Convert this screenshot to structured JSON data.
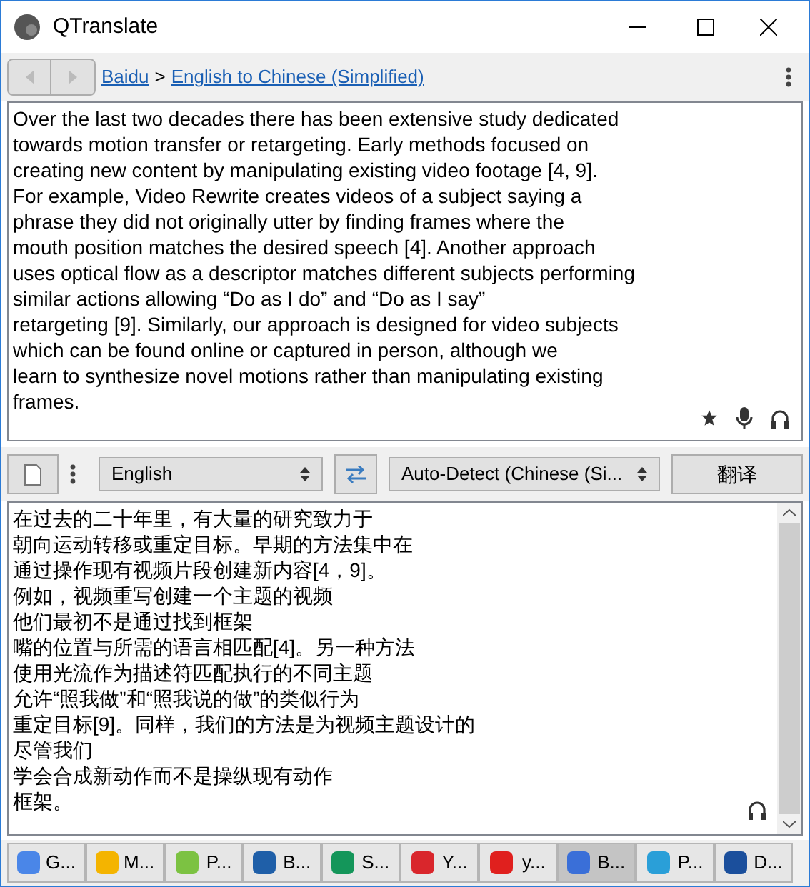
{
  "window": {
    "title": "QTranslate"
  },
  "nav": {
    "service": "Baidu",
    "separator": ">",
    "direction": "English to Chinese (Simplified)"
  },
  "source_text": [
    "Over the last two decades there has been extensive study dedicated",
    "towards motion transfer or retargeting. Early methods focused on",
    "creating new content by manipulating existing video footage [4, 9].",
    "For example, Video Rewrite creates videos of a subject saying a",
    "phrase they did not originally utter by finding frames where the",
    "mouth position matches the desired speech [4]. Another approach",
    "uses optical flow as a descriptor matches different subjects performing",
    "similar actions allowing “Do as I do” and “Do as I say”",
    "retargeting [9]. Similarly, our approach is designed for video subjects",
    "which can be found online or captured in person, although we",
    "learn to synthesize novel motions rather than manipulating existing",
    "frames."
  ],
  "toolbar": {
    "source_language": "English",
    "target_language": "Auto-Detect (Chinese (Si...",
    "translate_button": "翻译"
  },
  "translation_text": [
    "在过去的二十年里，有大量的研究致力于",
    "朝向运动转移或重定目标。早期的方法集中在",
    "通过操作现有视频片段创建新内容[4，9]。",
    "例如，视频重写创建一个主题的视频",
    "他们最初不是通过找到框架",
    "嘴的位置与所需的语言相匹配[4]。另一种方法",
    "使用光流作为描述符匹配执行的不同主题",
    "允许“照我做”和“照我说的做”的类似行为",
    "重定目标[9]。同样，我们的方法是为视频主题设计的",
    "尽管我们",
    "学会合成新动作而不是操纵现有动作",
    "框架。"
  ],
  "services": [
    {
      "label": "G...",
      "selected": false,
      "color": "#4a86e8"
    },
    {
      "label": "M...",
      "selected": false,
      "color": "#f4b400"
    },
    {
      "label": "P...",
      "selected": false,
      "color": "#7cc242"
    },
    {
      "label": "B...",
      "selected": false,
      "color": "#1f5fa8"
    },
    {
      "label": "S...",
      "selected": false,
      "color": "#14965a"
    },
    {
      "label": "Y...",
      "selected": false,
      "color": "#d9262c"
    },
    {
      "label": "y...",
      "selected": false,
      "color": "#e0201e"
    },
    {
      "label": "B...",
      "selected": true,
      "color": "#3a6fd8"
    },
    {
      "label": "P...",
      "selected": false,
      "color": "#2a9fd8"
    },
    {
      "label": "D...",
      "selected": false,
      "color": "#1b4f9c"
    }
  ]
}
